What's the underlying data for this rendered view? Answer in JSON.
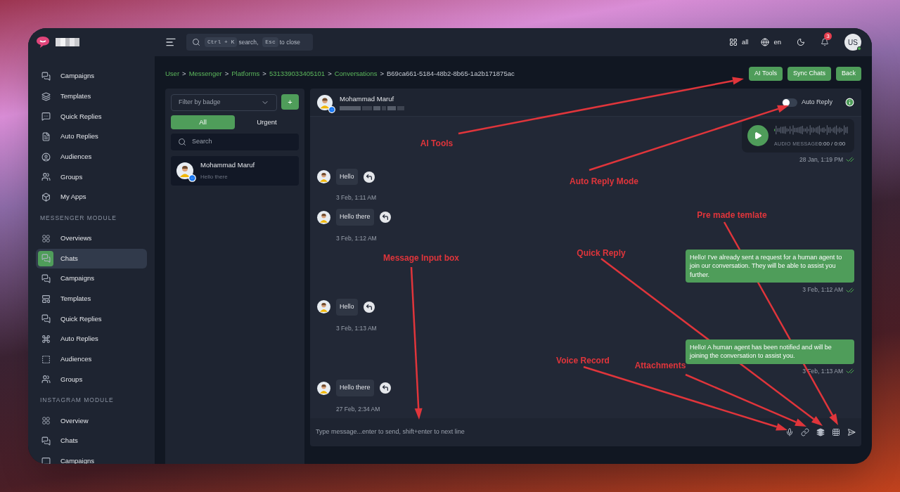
{
  "sidebar": {
    "sections": [
      {
        "items": [
          {
            "label": "Campaigns",
            "selected": false
          },
          {
            "label": "Templates",
            "selected": false
          },
          {
            "label": "Quick Replies",
            "selected": false
          },
          {
            "label": "Auto Replies",
            "selected": false
          },
          {
            "label": "Audiences",
            "selected": false
          },
          {
            "label": "Groups",
            "selected": false
          },
          {
            "label": "My Apps",
            "selected": false
          }
        ]
      },
      {
        "heading": "MESSENGER MODULE",
        "items": [
          {
            "label": "Overviews",
            "selected": false
          },
          {
            "label": "Chats",
            "selected": true
          },
          {
            "label": "Campaigns",
            "selected": false
          },
          {
            "label": "Templates",
            "selected": false
          },
          {
            "label": "Quick Replies",
            "selected": false
          },
          {
            "label": "Auto Replies",
            "selected": false
          },
          {
            "label": "Audiences",
            "selected": false
          },
          {
            "label": "Groups",
            "selected": false
          }
        ]
      },
      {
        "heading": "INSTAGRAM MODULE",
        "items": [
          {
            "label": "Overview",
            "selected": false
          },
          {
            "label": "Chats",
            "selected": false
          },
          {
            "label": "Campaigns",
            "selected": false
          }
        ]
      }
    ]
  },
  "topbar": {
    "search": {
      "shortcut": "Ctrl + K",
      "hint": "search,",
      "escape_key": "Esc",
      "hint_end": "to close"
    },
    "workspace": "all",
    "language": "en",
    "notifications": "3",
    "user": {
      "initials": "US",
      "online": true
    }
  },
  "breadcrumb": {
    "items": [
      {
        "label": "User",
        "link": true
      },
      {
        "label": "Messenger",
        "link": true
      },
      {
        "label": "Platforms",
        "link": true
      },
      {
        "label": "531339033405101",
        "link": true
      },
      {
        "label": "Conversations",
        "link": true
      },
      {
        "label": "B69ca661-5184-48b2-8b65-1a2b171875ac",
        "link": false
      }
    ],
    "separators": [
      ">",
      ">",
      ">",
      ">",
      ">"
    ]
  },
  "actions": [
    "AI Tools",
    "Sync Chats",
    "Back"
  ],
  "chat_list": {
    "filter": {
      "placeholder": "Filter by badge"
    },
    "add_button": "+",
    "tabs": [
      {
        "label": "All",
        "selected": true
      },
      {
        "label": "Urgent",
        "selected": false
      }
    ],
    "search": {
      "placeholder": "Search"
    },
    "items": [
      {
        "name": "Mohammad Maruf",
        "preview": "Hello there"
      }
    ]
  },
  "conversation": {
    "contact": {
      "name": "Mohammad Maruf"
    },
    "auto_reply": {
      "label": "Auto Reply",
      "on": false
    },
    "messages": [
      {
        "outgoing": true,
        "kind": "audio",
        "caption": "AUDIO MESSAGE",
        "duration": "0:00 / 0:00",
        "time": "28 Jan, 1:19 PM",
        "read": true
      },
      {
        "outgoing": false,
        "kind": "text",
        "text": "Hello",
        "time": "3 Feb, 1:11 AM"
      },
      {
        "outgoing": false,
        "kind": "text",
        "text": "Hello there",
        "time": "3 Feb, 1:12 AM"
      },
      {
        "outgoing": true,
        "kind": "text",
        "text": "Hello! I've already sent a request for a human agent to join our conversation. They will be able to assist you further.",
        "time": "3 Feb, 1:12 AM",
        "read": true
      },
      {
        "outgoing": false,
        "kind": "text",
        "text": "Hello",
        "time": "3 Feb, 1:13 AM"
      },
      {
        "outgoing": true,
        "kind": "text",
        "text": "Hello! A human agent has been notified and will be joining the conversation to assist you.",
        "time": "3 Feb, 1:13 AM",
        "read": true
      },
      {
        "outgoing": false,
        "kind": "text",
        "text": "Hello there",
        "time": "27 Feb, 2:34 AM"
      }
    ],
    "composer": {
      "placeholder": "Type message...enter to send, shift+enter to next line"
    }
  },
  "annotations": [
    {
      "label": "AI Tools"
    },
    {
      "label": "Auto Reply Mode"
    },
    {
      "label": "Pre made temlate"
    },
    {
      "label": "Quick Reply"
    },
    {
      "label": "Message Input box"
    },
    {
      "label": "Voice Record"
    },
    {
      "label": "Attachments"
    }
  ]
}
